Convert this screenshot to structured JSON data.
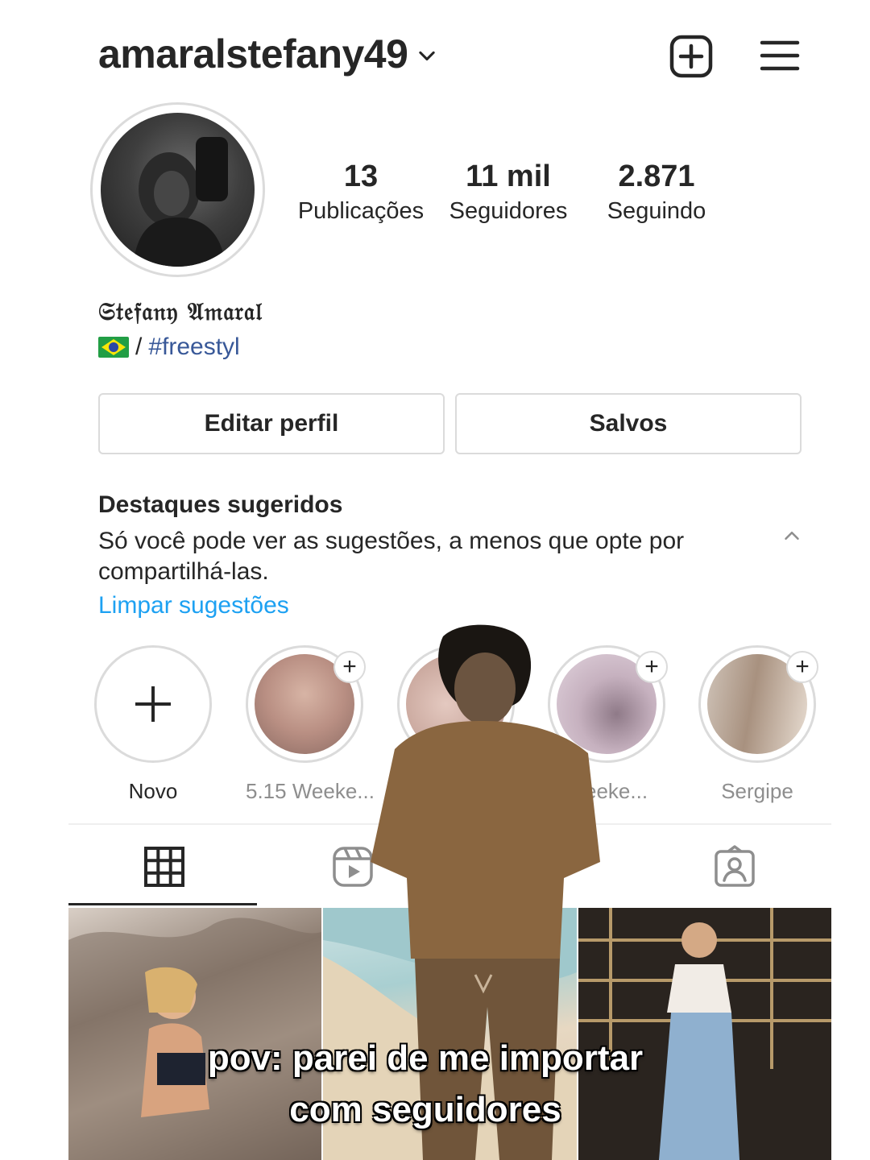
{
  "header": {
    "username": "amaralstefany49",
    "icons": {
      "account_switch": "chevron-down-icon",
      "new_post": "add-square-icon",
      "menu": "hamburger-menu-icon"
    }
  },
  "profile": {
    "stats": [
      {
        "value": "13",
        "label": "Publicações"
      },
      {
        "value": "11 mil",
        "label": "Seguidores"
      },
      {
        "value": "2.871",
        "label": "Seguindo"
      }
    ],
    "display_name": "𝔖𝔱𝔢𝔣𝔞𝔫𝔶 𝔄𝔪𝔞𝔯𝔞𝔩",
    "bio": {
      "separator": "/",
      "hashtag": "#freestyl"
    }
  },
  "actions": {
    "edit_profile": "Editar perfil",
    "saved": "Salvos"
  },
  "highlights": {
    "title": "Destaques sugeridos",
    "description": "Só você pode ver as sugestões, a menos que opte por compartilhá-las.",
    "clear_link": "Limpar sugestões",
    "items": [
      {
        "label": "Novo"
      },
      {
        "label": "5.15 Weeke..."
      },
      {
        "label": ""
      },
      {
        "label": "Weeke..."
      },
      {
        "label": "Sergipe"
      }
    ]
  },
  "tabs": {
    "grid": "grid-icon",
    "reels": "reels-icon",
    "tagged": "tagged-icon"
  },
  "caption": {
    "line1": "pov: parei de me importar",
    "line2": "com seguidores"
  },
  "colors": {
    "link_blue": "#1da1f2",
    "hashtag_blue": "#385898",
    "border": "#dbdbdb",
    "text": "#262626"
  }
}
